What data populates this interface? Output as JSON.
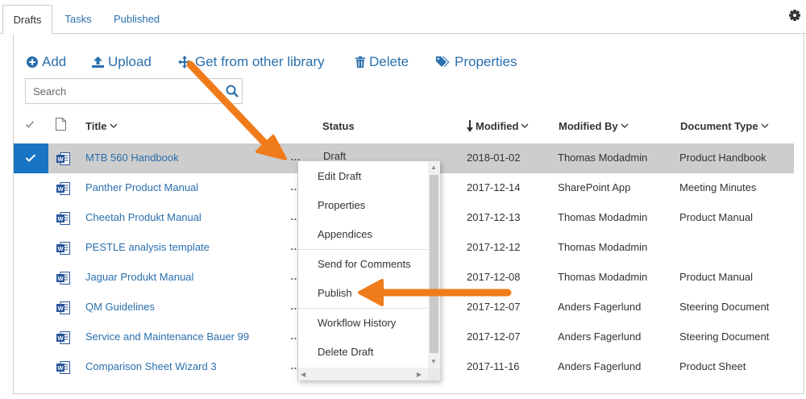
{
  "tabs": [
    {
      "label": "Drafts",
      "active": true
    },
    {
      "label": "Tasks",
      "active": false
    },
    {
      "label": "Published",
      "active": false
    }
  ],
  "toolbar": {
    "add_label": "Add",
    "upload_label": "Upload",
    "get_library_label": "Get from other library",
    "delete_label": "Delete",
    "properties_label": "Properties"
  },
  "search": {
    "placeholder": "Search",
    "value": ""
  },
  "columns": {
    "title": "Title",
    "status": "Status",
    "modified": "Modified",
    "modified_by": "Modified By",
    "document_type": "Document Type"
  },
  "rows": [
    {
      "title": "MTB 560 Handbook",
      "status": "Draft",
      "modified": "2018-01-02",
      "modified_by": "Thomas Modadmin",
      "document_type": "Product Handbook",
      "selected": true
    },
    {
      "title": "Panther Product Manual",
      "status": "",
      "modified": "2017-12-14",
      "modified_by": "SharePoint App",
      "document_type": "Meeting Minutes",
      "selected": false
    },
    {
      "title": "Cheetah Produkt Manual",
      "status": "",
      "modified": "2017-12-13",
      "modified_by": "Thomas Modadmin",
      "document_type": "Product Manual",
      "selected": false
    },
    {
      "title": "PESTLE analysis template",
      "status": "",
      "modified": "2017-12-12",
      "modified_by": "Thomas Modadmin",
      "document_type": "",
      "selected": false
    },
    {
      "title": "Jaguar Produkt Manual",
      "status": "",
      "modified": "2017-12-08",
      "modified_by": "Thomas Modadmin",
      "document_type": "Product Manual",
      "selected": false
    },
    {
      "title": "QM Guidelines",
      "status": "",
      "modified": "2017-12-07",
      "modified_by": "Anders Fagerlund",
      "document_type": "Steering Document",
      "selected": false
    },
    {
      "title": "Service and Maintenance Bauer 99",
      "status": "",
      "modified": "2017-12-07",
      "modified_by": "Anders Fagerlund",
      "document_type": "Steering Document",
      "selected": false
    },
    {
      "title": "Comparison Sheet Wizard 3",
      "status": "",
      "modified": "2017-11-16",
      "modified_by": "Anders Fagerlund",
      "document_type": "Product Sheet",
      "selected": false
    }
  ],
  "context_menu": {
    "items": [
      "Edit Draft",
      "Properties",
      "Appendices",
      "Send for Comments",
      "Publish",
      "Workflow History",
      "Delete Draft"
    ]
  },
  "colors": {
    "link": "#2a6fad",
    "selection": "#1a74c4",
    "selected_row": "#cdcdcd",
    "annotation_arrow": "#f07b1a"
  },
  "icons": {
    "settings": "gear-icon",
    "add": "plus-circle-icon",
    "upload": "upload-icon",
    "move": "move-arrows-icon",
    "delete": "trash-icon",
    "properties": "tags-icon",
    "search": "search-icon",
    "file_type": "word-document-icon"
  }
}
